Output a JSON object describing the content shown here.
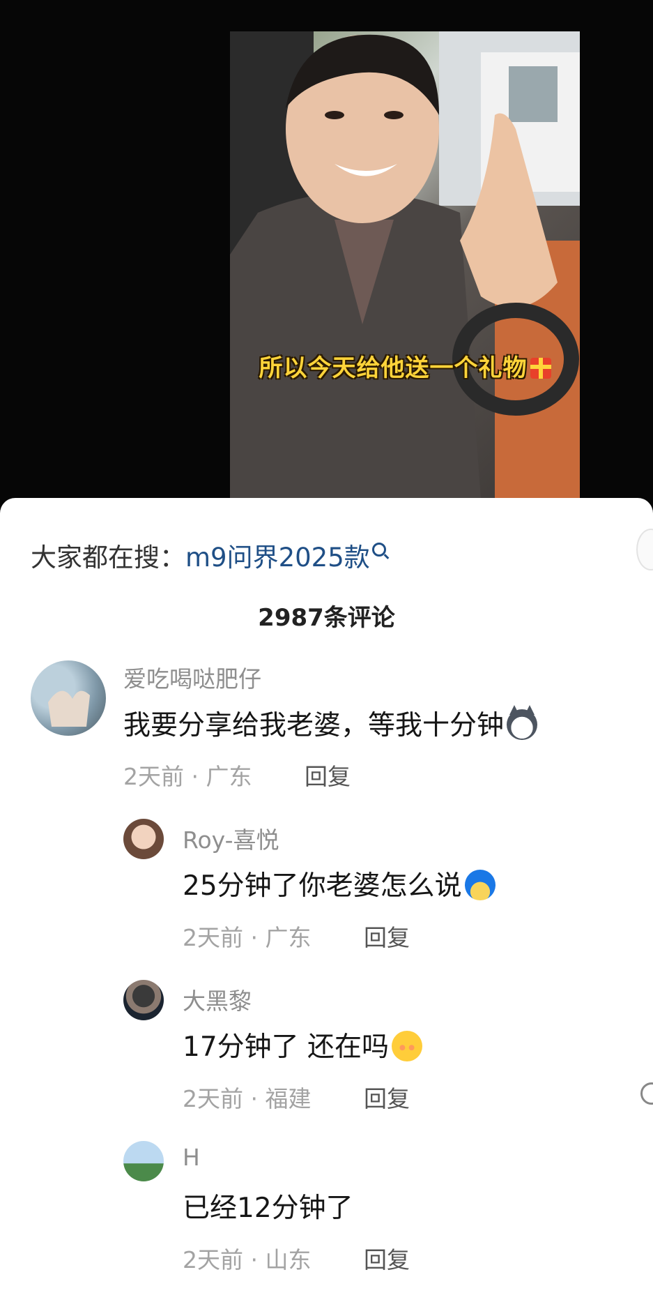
{
  "video": {
    "caption": "所以今天给他送一个礼物"
  },
  "search_hint": {
    "prefix": "大家都在搜：",
    "keyword": "m9问界2025款"
  },
  "comment_count": "2987条评论",
  "comments": [
    {
      "username": "爱吃喝哒肥仔",
      "text": "我要分享给我老婆，等我十分钟",
      "meta": "2天前 · 广东",
      "reply": "回复"
    },
    {
      "username": "Roy-喜悦",
      "text": "25分钟了你老婆怎么说",
      "meta": "2天前 · 广东",
      "reply": "回复"
    },
    {
      "username": "大黑黎",
      "text": "17分钟了 还在吗",
      "meta": "2天前 · 福建",
      "reply": "回复"
    },
    {
      "username": "H",
      "text": "已经12分钟了",
      "meta": "2天前 · 山东",
      "reply": "回复"
    }
  ],
  "icons": {
    "search": "search-icon",
    "gift": "gift-icon",
    "emoji_1": "husky-emoji-icon",
    "emoji_2": "blue-hair-emoji-icon",
    "emoji_3": "shy-emoji-icon"
  }
}
